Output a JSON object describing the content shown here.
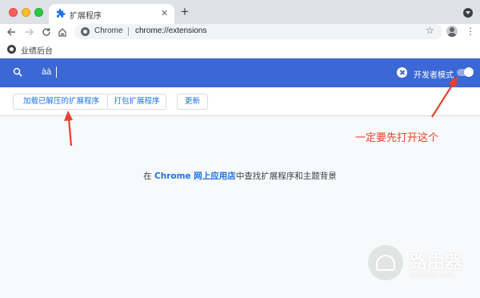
{
  "browser": {
    "tab_title": "扩展程序",
    "tab_close_glyph": "✕",
    "new_tab_glyph": "+",
    "site_label": "Chrome",
    "url": "chrome://extensions",
    "bookmark_label": "业绩后台",
    "icons": [
      "extension-icon",
      "back-icon",
      "forward-icon",
      "reload-icon",
      "home-icon",
      "star-icon",
      "avatar-icon",
      "menu-icon"
    ]
  },
  "header": {
    "search_value": "àà",
    "dev_mode_label": "开发者模式",
    "dev_mode_on": true,
    "accent_color": "#3b68d4"
  },
  "actions": {
    "load_unpacked": "加载已解压的扩展程序",
    "pack": "打包扩展程序",
    "update": "更新"
  },
  "content": {
    "prefix": "在 ",
    "store_link": "Chrome 网上应用店",
    "suffix": "中查找扩展程序和主题背景"
  },
  "annotation": {
    "text": "一定要先打开这个",
    "color": "#e8412b"
  },
  "watermark": {
    "title": "路由器",
    "subtitle": "luyouqi.com"
  }
}
